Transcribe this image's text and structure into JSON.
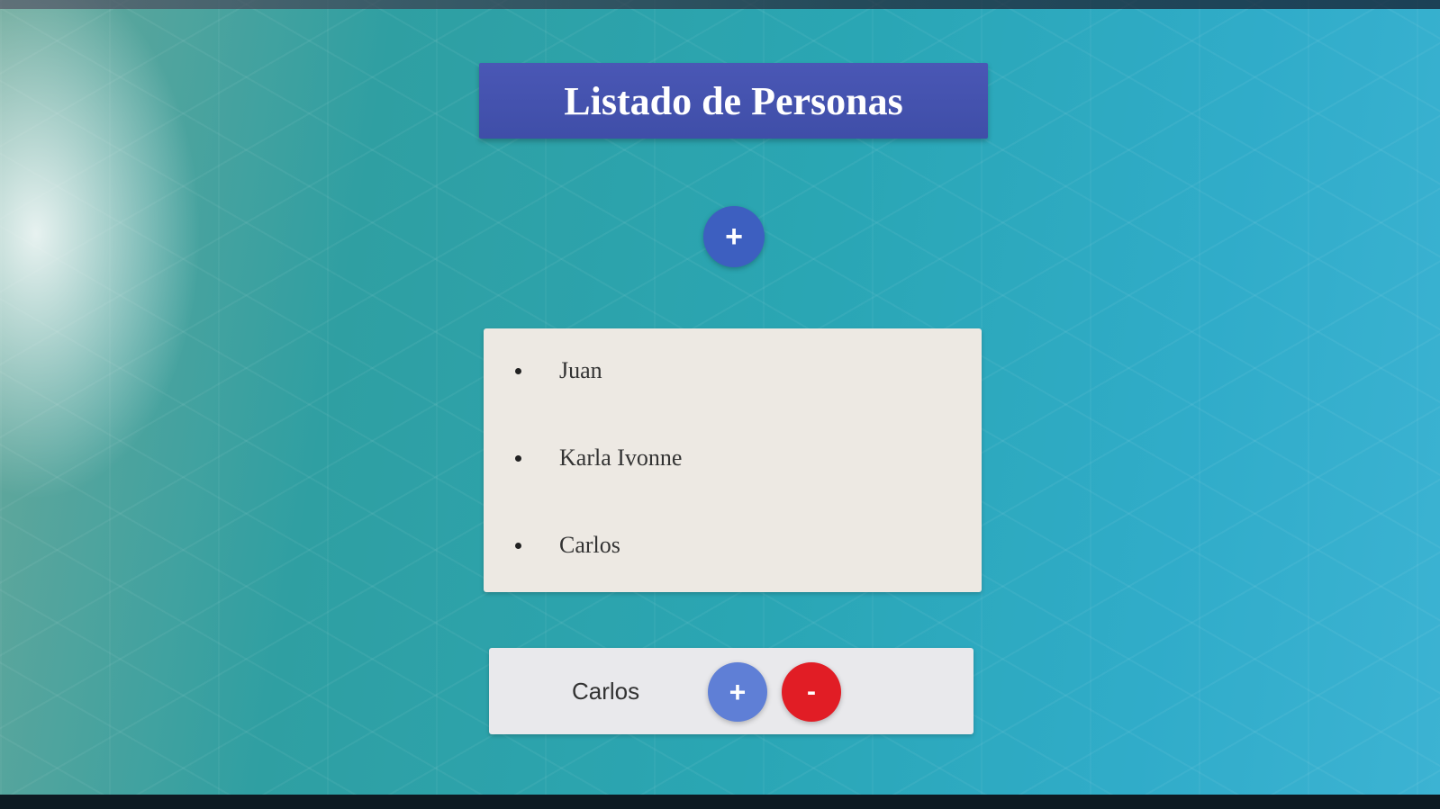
{
  "header": {
    "title": "Listado de Personas"
  },
  "add_button": {
    "label": "+",
    "icon": "plus-icon",
    "color": "#3d5fc0"
  },
  "people": {
    "items": [
      {
        "name": "Juan"
      },
      {
        "name": "Karla Ivonne"
      },
      {
        "name": "Carlos"
      }
    ]
  },
  "selected_person": {
    "name": "Carlos",
    "increment_label": "+",
    "decrement_label": "-",
    "increment_color": "#5f7fd6",
    "decrement_color": "#e11d25"
  },
  "colors": {
    "title_background": "#4a57b5",
    "card_background": "#ede9e3"
  }
}
